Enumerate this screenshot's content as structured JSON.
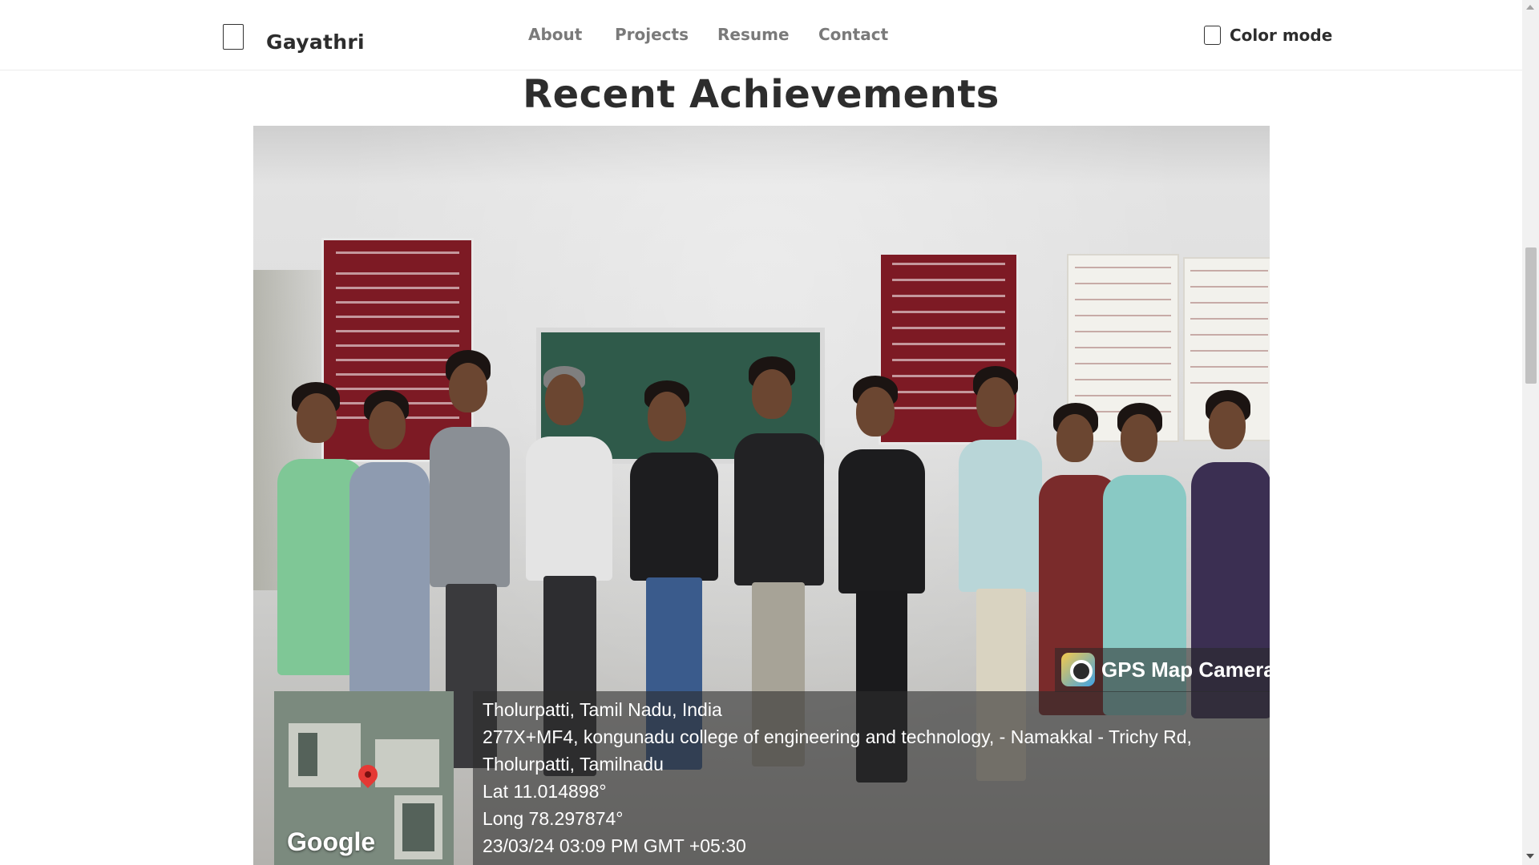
{
  "navbar": {
    "brand": "Gayathri",
    "links": [
      "About",
      "Projects",
      "Resume",
      "Contact"
    ],
    "color_mode_label": "Color mode"
  },
  "section": {
    "title": "Recent Achievements"
  },
  "photo": {
    "overlay_app": "GPS Map Camera",
    "map_label": "Google",
    "location_lines": [
      "Tholurpatti, Tamil Nadu, India",
      "277X+MF4, kongunadu college of engineering and technology, - Namakkal - Trichy Rd,",
      "Tholurpatti, Tamilnadu",
      "Lat 11.014898°",
      "Long 78.297874°",
      "23/03/24 03:09 PM GMT +05:30"
    ]
  },
  "icons": {
    "brand": "logo-box-icon",
    "color_mode": "checkbox-icon",
    "gps": "gps-map-camera-icon",
    "pin": "map-pin-icon"
  }
}
